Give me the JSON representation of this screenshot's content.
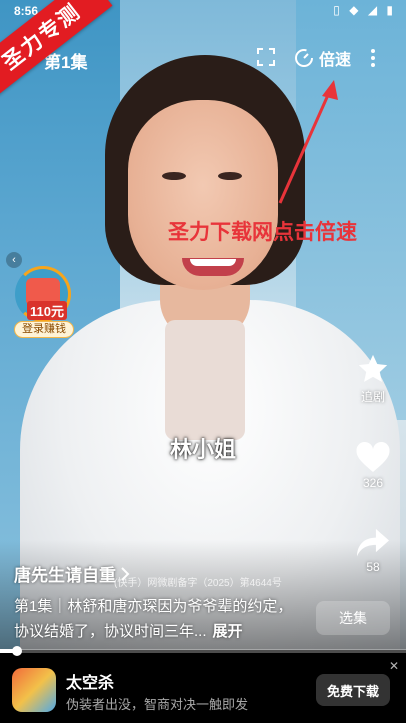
{
  "status_bar": {
    "time": "8:56"
  },
  "top_bar": {
    "episode_title": "第1集",
    "speed_label": "倍速"
  },
  "promo": {
    "ribbon_text": "圣力专测",
    "annotation_text": "圣力下载网点击倍速"
  },
  "reward": {
    "amount": "110元",
    "label": "登录赚钱"
  },
  "subtitle": "林小姐",
  "side_actions": {
    "follow_label": "追剧",
    "like_count": "326",
    "share_count": "58"
  },
  "drama": {
    "title": "唐先生请自重",
    "license": "(快手）网微剧备字（2025）第4644号",
    "description": "第1集｜林舒和唐亦琛因为爷爷辈的约定，协议结婚了，协议时间三年...",
    "expand_label": "展开",
    "select_episode_label": "选集"
  },
  "progress": {
    "fraction": 0.04
  },
  "ad": {
    "title": "太空杀",
    "description": "伪装者出没，智商对决一触即发",
    "download_label": "免费下载",
    "close_label": "✕"
  },
  "colors": {
    "accent_red": "#e21c22",
    "annotation_red": "#e8343a"
  }
}
